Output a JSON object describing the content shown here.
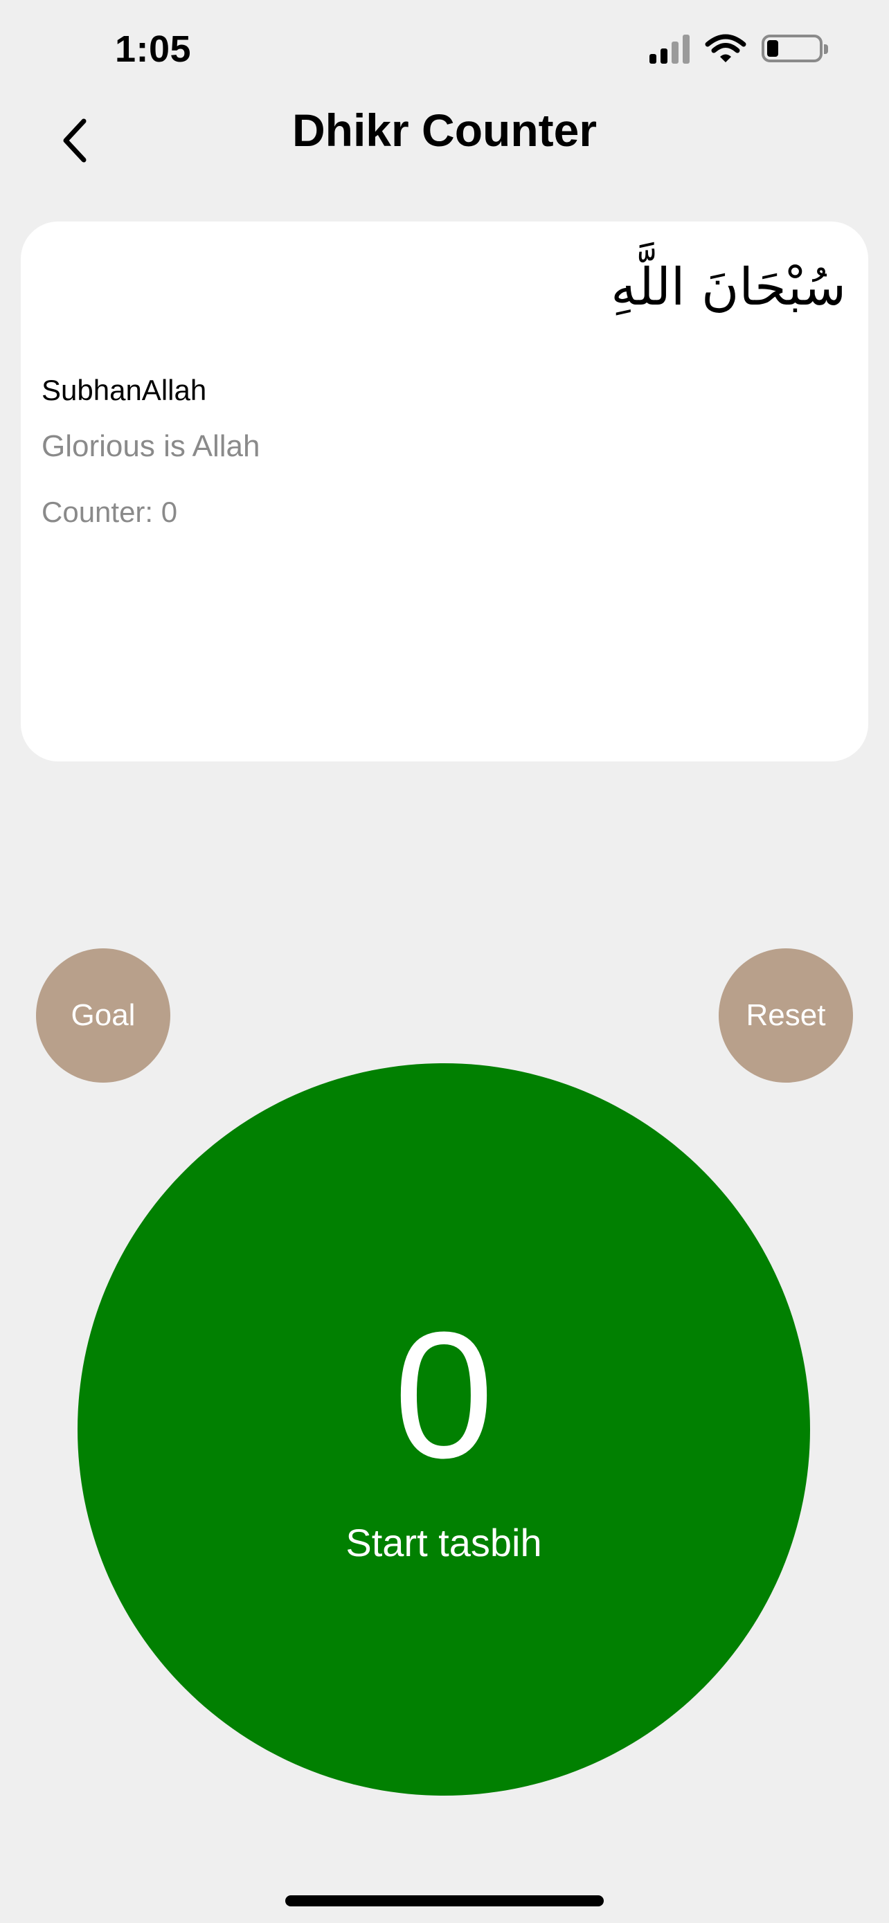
{
  "status_bar": {
    "time": "1:05",
    "signal_icon": "cellular-signal-icon",
    "wifi_icon": "wifi-icon",
    "battery_icon": "battery-icon",
    "battery_level": 0.22
  },
  "header": {
    "back_icon": "chevron-left-icon",
    "title": "Dhikr Counter"
  },
  "dhikr_card": {
    "arabic": "سُبْحَانَ اللَّهِ",
    "transliteration": "SubhanAllah",
    "translation": "Glorious is Allah",
    "counter_text": "Counter: 0"
  },
  "actions": {
    "goal_label": "Goal",
    "reset_label": "Reset"
  },
  "tasbih": {
    "count": "0",
    "label": "Start tasbih"
  },
  "colors": {
    "background": "#efefef",
    "card": "#ffffff",
    "round_button": "#b8a08b",
    "tasbih": "#018001",
    "secondary_text": "#8a8a8a"
  }
}
